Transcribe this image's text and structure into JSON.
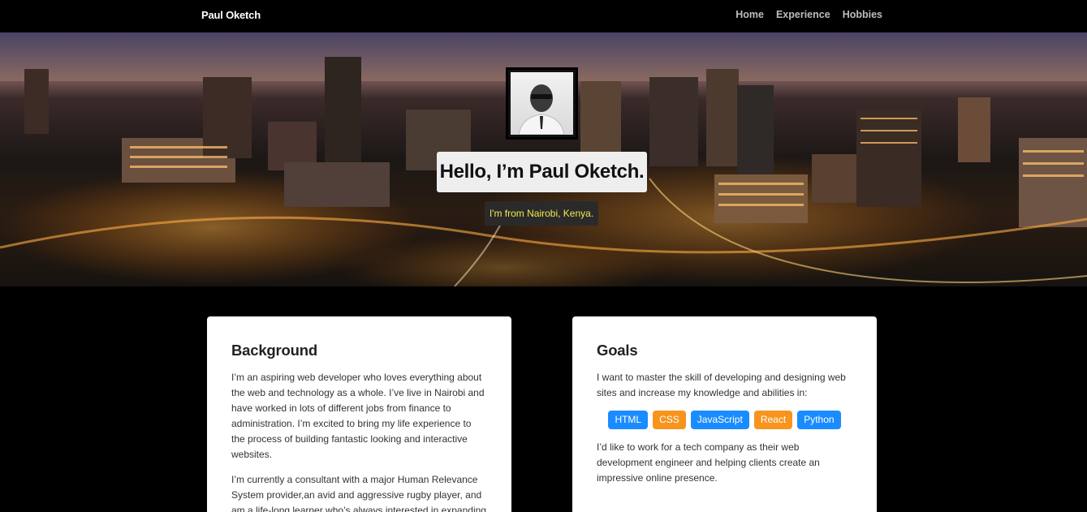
{
  "navbar": {
    "brand": "Paul Oketch",
    "links": [
      {
        "label": "Home"
      },
      {
        "label": "Experience"
      },
      {
        "label": "Hobbies"
      }
    ]
  },
  "hero": {
    "title": "Hello, I’m Paul Oketch.",
    "subtitle": "I'm from Nairobi, Kenya."
  },
  "background": {
    "heading": "Background",
    "paragraphs": [
      "I’m an aspiring web developer who loves everything about the web and technology as a whole. I’ve live in Nairobi and have worked in lots of different jobs from finance to administration. I’m excited to bring my life experience to the process of building fantastic looking and interactive websites.",
      "I’m currently a consultant with a major Human Relevance System provider,an avid and aggressive rugby player, and am a life-long learner who’s always interested in expanding"
    ]
  },
  "goals": {
    "heading": "Goals",
    "intro": "I want to master the skill of developing and designing web sites and increase my knowledge and abilities in:",
    "skills": [
      {
        "label": "HTML",
        "color": "#1a8cff"
      },
      {
        "label": "CSS",
        "color": "#f7941d"
      },
      {
        "label": "JavaScript",
        "color": "#1a8cff"
      },
      {
        "label": "React",
        "color": "#f7941d"
      },
      {
        "label": "Python",
        "color": "#1a8cff"
      }
    ],
    "outro": "I’d like to work for a tech company as their web development engineer and helping clients create an impressive online presence."
  }
}
